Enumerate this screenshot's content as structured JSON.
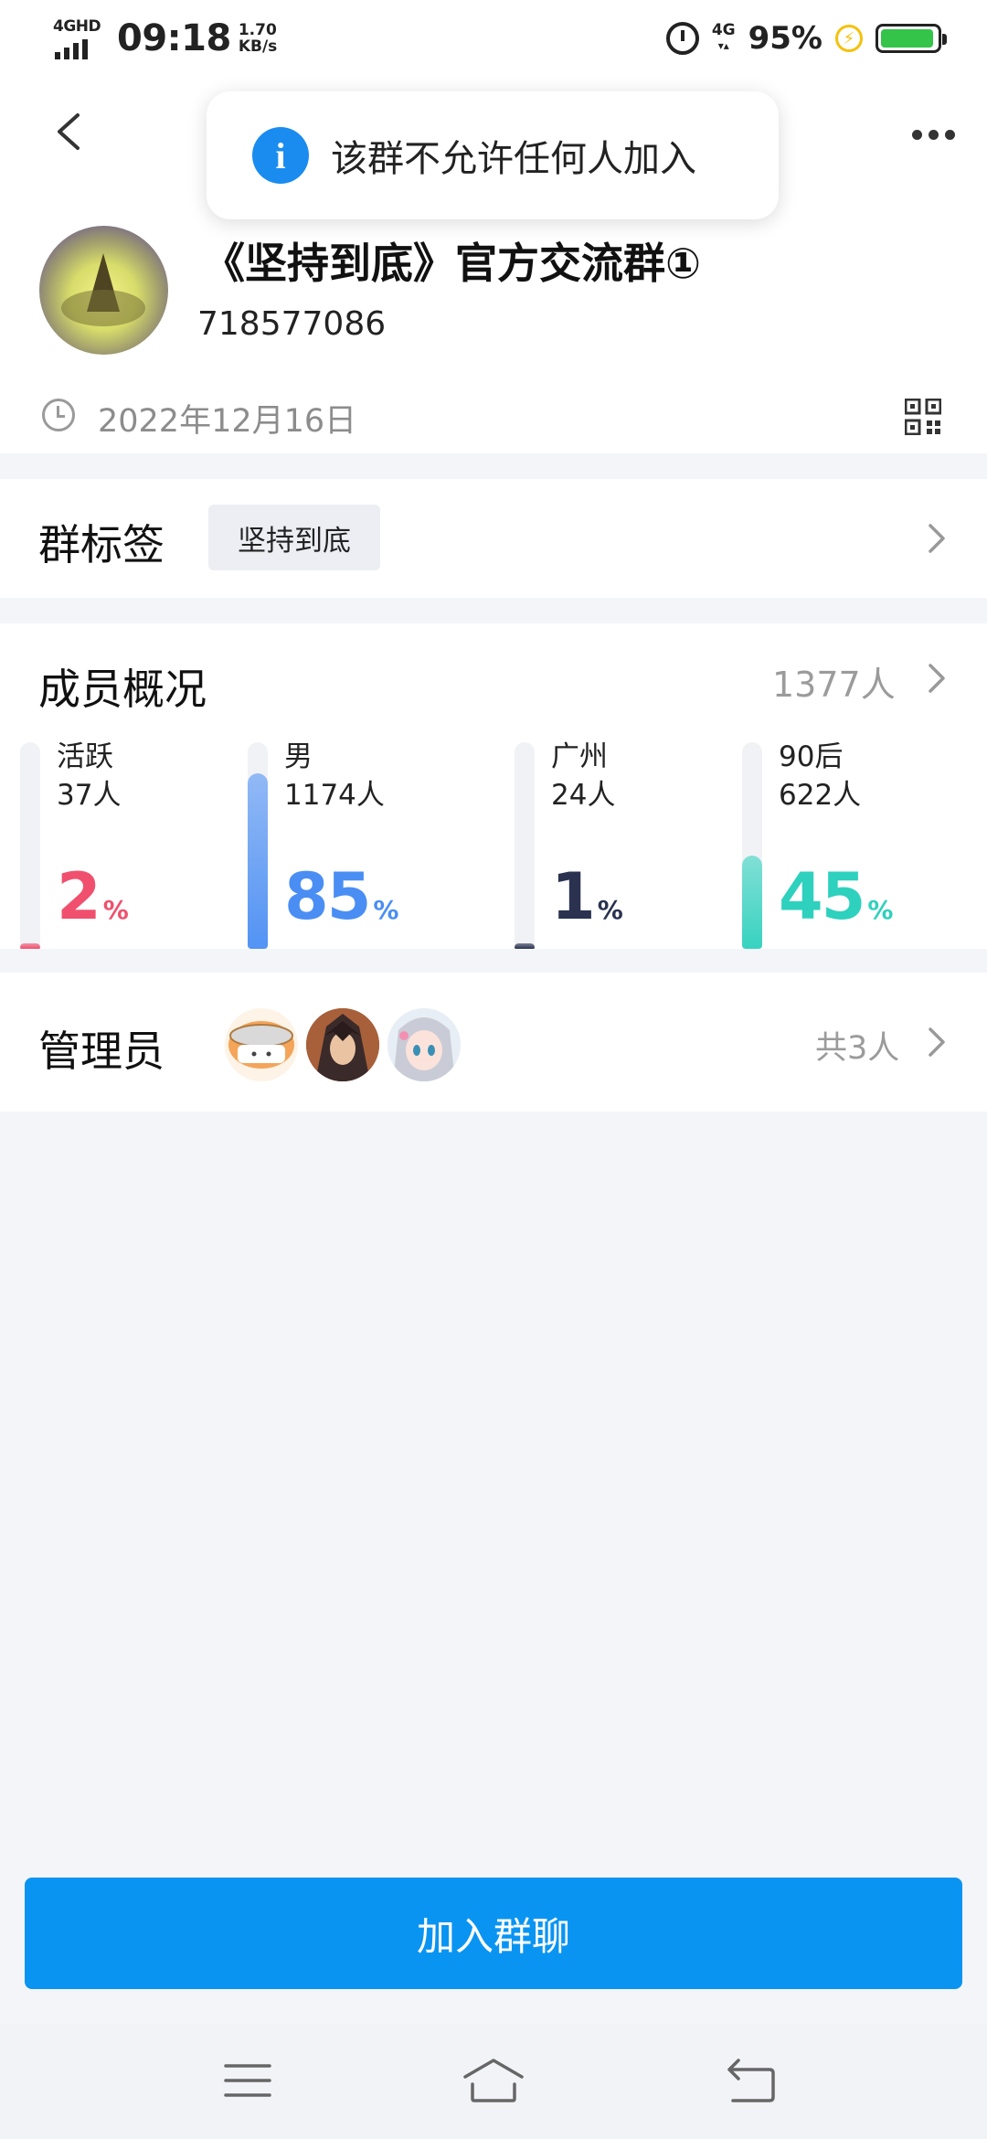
{
  "status_bar": {
    "network": "4GHD",
    "time": "09:18",
    "speed_value": "1.70",
    "speed_unit": "KB/s",
    "network_right": "4G",
    "battery_percent": "95%",
    "battery_level": 0.95,
    "battery_color": "#34c44a"
  },
  "toast": {
    "icon": "info-icon",
    "icon_glyph": "i",
    "message": "该群不允许任何人加入"
  },
  "group": {
    "name": "《坚持到底》官方交流群①",
    "id": "718577086",
    "created_date": "2022年12月16日"
  },
  "tags": {
    "title": "群标签",
    "items": [
      "坚持到底"
    ]
  },
  "members": {
    "title": "成员概况",
    "total": "1377人",
    "stats": [
      {
        "label": "活跃",
        "count": "37人",
        "percent": "2",
        "percent_sign": "%",
        "level": 0.02,
        "color": "#f0506e"
      },
      {
        "label": "男",
        "count": "1174人",
        "percent": "85",
        "percent_sign": "%",
        "level": 0.85,
        "color": "#4a8ef4"
      },
      {
        "label": "广州",
        "count": "24人",
        "percent": "1",
        "percent_sign": "%",
        "level": 0.01,
        "color": "#2a3250"
      },
      {
        "label": "90后",
        "count": "622人",
        "percent": "45",
        "percent_sign": "%",
        "level": 0.45,
        "color": "#2ed1bd"
      }
    ]
  },
  "admins": {
    "title": "管理员",
    "total": "共3人"
  },
  "join": {
    "label": "加入群聊"
  },
  "colors": {
    "accent": "#0a94f2",
    "toast_icon": "#1a8cf0"
  }
}
